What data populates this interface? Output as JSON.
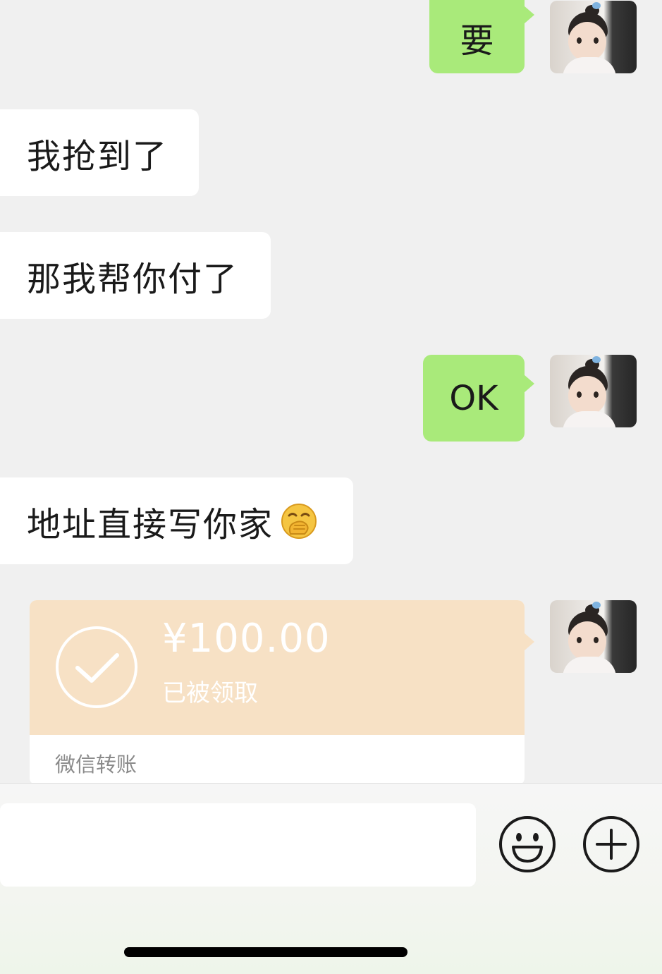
{
  "messages": {
    "m1": {
      "text": "要",
      "from": "me"
    },
    "m2": {
      "text": "我抢到了",
      "from": "them"
    },
    "m3": {
      "text": "那我帮你付了",
      "from": "them"
    },
    "m4": {
      "text": "OK",
      "from": "me"
    },
    "m5": {
      "text": "地址直接写你家",
      "emoji": "hand-over-mouth-emoji",
      "from": "them"
    }
  },
  "transfer": {
    "amount": "¥100.00",
    "status": "已被领取",
    "source": "微信转账",
    "from": "me"
  },
  "input_bar": {
    "placeholder": "",
    "emoji_button_icon": "smiley-icon",
    "more_button_icon": "plus-circle-icon"
  },
  "colors": {
    "background": "#f0f0f0",
    "outgoing_bubble": "#a9ea7a",
    "incoming_bubble": "#ffffff",
    "transfer_card": "#f7e1c5"
  }
}
